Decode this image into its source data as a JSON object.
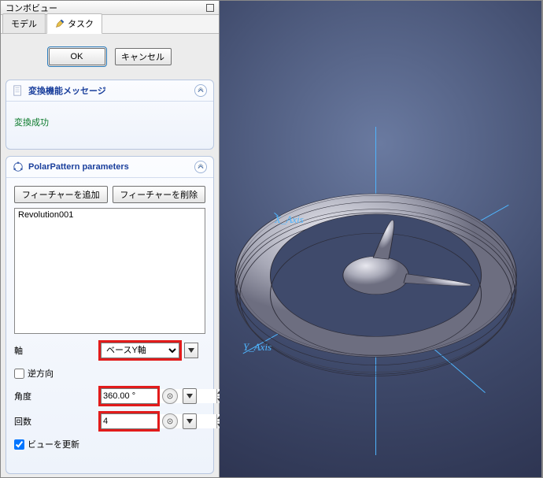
{
  "panel_title": "コンボビュー",
  "tabs": {
    "model": "モデル",
    "task": "タスク"
  },
  "buttons": {
    "ok": "OK",
    "cancel": "キャンセル"
  },
  "message_section": {
    "title": "変換機能メッセージ",
    "body": "変換成功"
  },
  "params_section": {
    "title": "PolarPattern parameters",
    "add_feature": "フィーチャーを追加",
    "remove_feature": "フィーチャーを削除",
    "features": [
      "Revolution001"
    ],
    "axis_label": "軸",
    "axis_value": "ベースY軸",
    "reverse_label": "逆方向",
    "reverse_checked": false,
    "angle_label": "角度",
    "angle_value": "360.00 °",
    "occ_label": "回数",
    "occ_value": "4",
    "update_label": "ビューを更新",
    "update_checked": true
  },
  "viewport": {
    "axis_y": "Y_Axis",
    "axis_x": "X_Axis"
  }
}
